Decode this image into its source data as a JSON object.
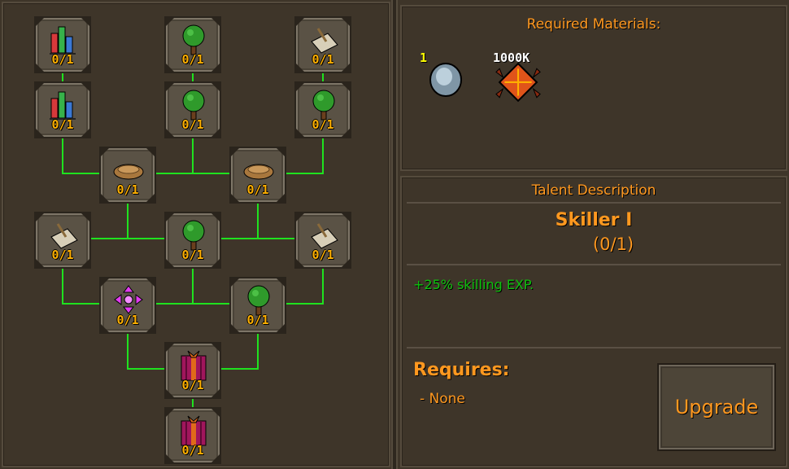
{
  "talent_tree": {
    "nodes": [
      {
        "id": "n1",
        "icon": "bar-chart-icon",
        "count": "0/1"
      },
      {
        "id": "n2",
        "icon": "tree-icon",
        "count": "0/1"
      },
      {
        "id": "n3",
        "icon": "scroll-icon",
        "count": "0/1"
      },
      {
        "id": "n4",
        "icon": "bar-chart-icon",
        "count": "0/1"
      },
      {
        "id": "n5",
        "icon": "tree-icon",
        "count": "0/1"
      },
      {
        "id": "n6",
        "icon": "tree-icon",
        "count": "0/1"
      },
      {
        "id": "n7",
        "icon": "bowl-icon",
        "count": "0/1"
      },
      {
        "id": "n8",
        "icon": "bowl-icon",
        "count": "0/1"
      },
      {
        "id": "n9",
        "icon": "scroll-icon",
        "count": "0/1"
      },
      {
        "id": "n10",
        "icon": "tree-icon",
        "count": "0/1"
      },
      {
        "id": "n11",
        "icon": "scroll-icon",
        "count": "0/1"
      },
      {
        "id": "n12",
        "icon": "magenta-arrows-icon",
        "count": "0/1"
      },
      {
        "id": "n13",
        "icon": "tree-icon",
        "count": "0/1"
      },
      {
        "id": "n14",
        "icon": "gift-box-icon",
        "count": "0/1"
      },
      {
        "id": "n15",
        "icon": "gift-box-icon",
        "count": "0/1"
      }
    ]
  },
  "materials": {
    "title": "Required Materials:",
    "items": [
      {
        "icon": "grey-stone-icon",
        "quantity": "1"
      },
      {
        "icon": "orange-spiked-orb-icon",
        "quantity": "1000K"
      }
    ]
  },
  "description": {
    "title": "Talent Description",
    "talent_name": "Skiller I",
    "talent_level": "(0/1)",
    "effect": "+25% skilling EXP.",
    "requires_title": "Requires:",
    "requires_value": "- None",
    "upgrade_label": "Upgrade"
  },
  "colors": {
    "background": "#3e3529",
    "accent_orange": "#ff981f",
    "connector_green": "#1fe21f",
    "effect_green": "#0dc10d",
    "count_yellow": "#ffb000"
  }
}
